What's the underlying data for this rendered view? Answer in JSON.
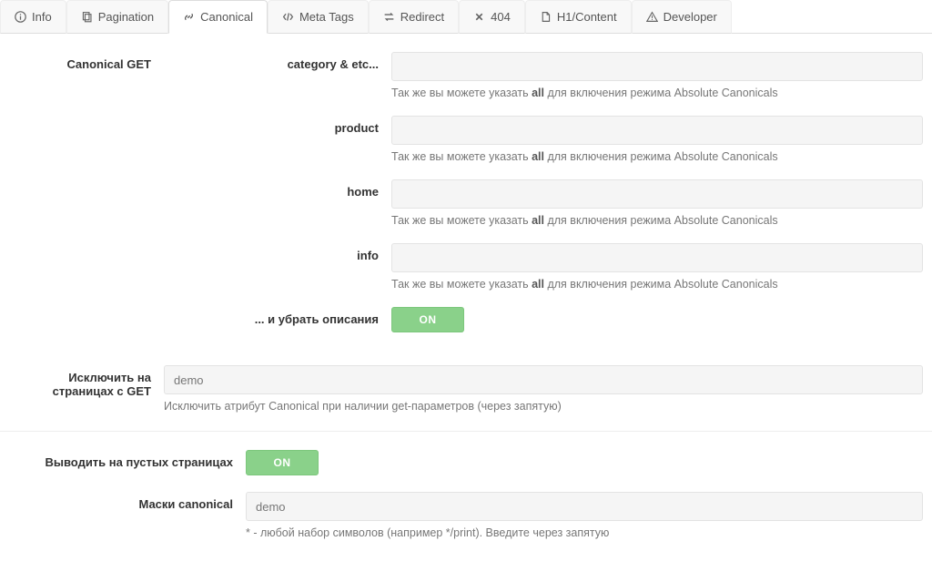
{
  "tabs": [
    {
      "id": "info",
      "label": "Info",
      "icon": "info-icon"
    },
    {
      "id": "pagination",
      "label": "Pagination",
      "icon": "copy-icon"
    },
    {
      "id": "canonical",
      "label": "Canonical",
      "icon": "link-icon",
      "active": true
    },
    {
      "id": "metatags",
      "label": "Meta Tags",
      "icon": "code-icon"
    },
    {
      "id": "redirect",
      "label": "Redirect",
      "icon": "exchange-icon"
    },
    {
      "id": "404",
      "label": "404",
      "icon": "times-icon"
    },
    {
      "id": "h1content",
      "label": "H1/Content",
      "icon": "file-icon"
    },
    {
      "id": "developer",
      "label": "Developer",
      "icon": "warning-icon"
    }
  ],
  "canonical_get": {
    "section_label": "Canonical GET",
    "help_prefix": "Так же вы можете указать ",
    "help_bold": "all",
    "help_suffix": " для включения режима Absolute Canonicals",
    "fields": [
      {
        "label": "category & etc...",
        "value": ""
      },
      {
        "label": "product",
        "value": ""
      },
      {
        "label": "home",
        "value": ""
      },
      {
        "label": "info",
        "value": ""
      }
    ],
    "remove_descriptions_label": "... и убрать описания",
    "remove_descriptions_state": "ON"
  },
  "exclude_get": {
    "label_l1": "Исключить на",
    "label_l2": "страницах с GET",
    "value": "demo",
    "help": "Исключить атрибут Canonical при наличии get-параметров (через запятую)"
  },
  "show_on_empty": {
    "label": "Выводить на пустых страницах",
    "state": "ON"
  },
  "masks": {
    "label": "Маски canonical",
    "value": "demo",
    "help": "* - любой набор символов (например */print). Введите через запятую"
  }
}
